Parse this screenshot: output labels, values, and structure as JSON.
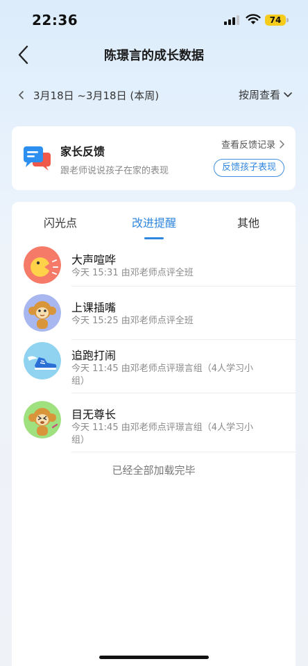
{
  "status_bar": {
    "time": "22:36",
    "battery": "74"
  },
  "nav": {
    "title": "陈璟言的成长数据"
  },
  "date_row": {
    "range": "3月18日 ~3月18日 (本周)",
    "view_mode": "按周查看"
  },
  "feedback": {
    "title": "家长反馈",
    "subtitle": "跟老师说说孩子在家的表现",
    "history_link": "查看反馈记录",
    "action_button": "反馈孩子表现"
  },
  "tabs": [
    {
      "label": "闪光点",
      "active": false
    },
    {
      "label": "改进提醒",
      "active": true
    },
    {
      "label": "其他",
      "active": false
    }
  ],
  "items": [
    {
      "title": "大声喧哗",
      "meta": "今天 15:31 由邓老师点评全班",
      "icon": "shouting-face-icon"
    },
    {
      "title": "上课插嘴",
      "meta": "今天 15:25 由邓老师点评全班",
      "icon": "monkey-icon"
    },
    {
      "title": "追跑打闹",
      "meta": "今天 11:45 由邓老师点评璟言组（4人学习小组）",
      "icon": "winged-shoe-icon"
    },
    {
      "title": "目无尊长",
      "meta": "今天 11:45 由邓老师点评璟言组（4人学习小组）",
      "icon": "monkey-upset-icon"
    }
  ],
  "end_text": "已经全部加载完毕",
  "colors": {
    "accent": "#2f86df",
    "battery": "#f5cc1b"
  }
}
